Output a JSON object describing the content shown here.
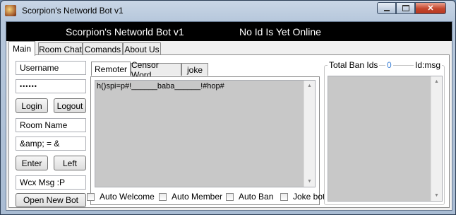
{
  "window": {
    "title": "Scorpion's Networld Bot v1",
    "icon": "scorpion-app-icon",
    "controls": {
      "minimize": "minimize-icon",
      "maximize": "maximize-icon",
      "close": "close-icon"
    }
  },
  "banner": {
    "title": "Scorpion's Networld Bot v1",
    "status": "No Id Is Yet Online"
  },
  "tabs": [
    {
      "label": "Main",
      "active": true
    },
    {
      "label": "Room Chat"
    },
    {
      "label": "Comands"
    },
    {
      "label": "About Us"
    }
  ],
  "main": {
    "username": "Username",
    "password": "••••••",
    "login_label": "Login",
    "logout_label": "Logout",
    "room_name": "Room Name",
    "room_code": "&amp; = &",
    "enter_label": "Enter",
    "left_label": "Left",
    "welcome_msg": "Wcx Msg :P",
    "open_new_bot_label": "Open New Bot",
    "inner_tabs": [
      {
        "label": "Remoter",
        "active": true
      },
      {
        "label": "Censor Word"
      },
      {
        "label": "joke"
      }
    ],
    "remoter_text": "h()spi=p#!______baba______!#hop#",
    "checkboxes": [
      {
        "label": "Auto Welcome",
        "checked": false
      },
      {
        "label": "Auto Member",
        "checked": false
      },
      {
        "label": "Auto Ban",
        "checked": false
      },
      {
        "label": "Joke bot",
        "checked": false
      }
    ],
    "ban_group": {
      "label": "Total Ban Ids",
      "count": "0",
      "column": "Id:msg"
    }
  },
  "colors": {
    "banner_bg": "#000000",
    "count_color": "#3a7fd5",
    "list_bg": "#c8c8c8"
  }
}
